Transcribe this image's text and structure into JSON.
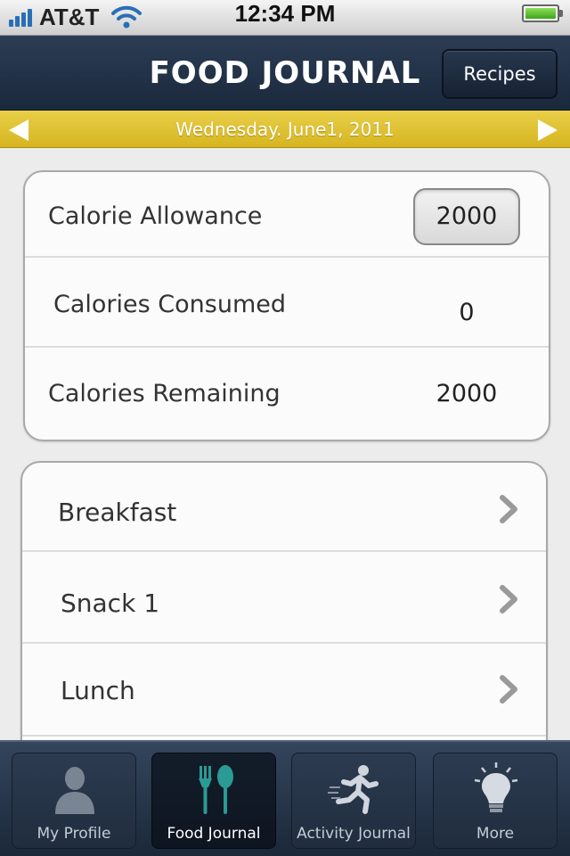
{
  "status_bar": {
    "carrier": "AT&T",
    "time": "12:34 PM"
  },
  "nav_bar": {
    "title": "FOOD JOURNAL",
    "recipes_label": "Recipes"
  },
  "date_bar": {
    "date": "Wednesday. June1, 2011"
  },
  "calories": {
    "allowance_label": "Calorie Allowance",
    "allowance_value": "2000",
    "consumed_label": "Calories Consumed",
    "consumed_value": "0",
    "remaining_label": "Calories Remaining",
    "remaining_value": "2000"
  },
  "meals": [
    {
      "label": "Breakfast"
    },
    {
      "label": "Snack 1"
    },
    {
      "label": "Lunch"
    }
  ],
  "tab_bar": {
    "tabs": [
      {
        "label": "My Profile"
      },
      {
        "label": "Food Journal"
      },
      {
        "label": "Activity Journal"
      },
      {
        "label": "More"
      }
    ],
    "active": "Food Journal"
  },
  "colors": {
    "nav_bg": "#1f2e44",
    "date_bar": "#ddbf2c",
    "food_icon": "#2a9a94"
  }
}
